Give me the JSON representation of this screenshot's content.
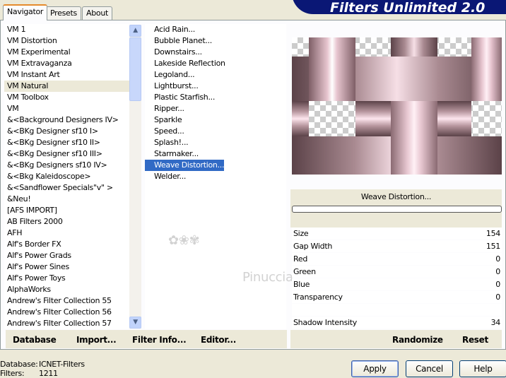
{
  "title": "Filters Unlimited 2.0",
  "tabs": [
    {
      "label": "Navigator"
    },
    {
      "label": "Presets"
    },
    {
      "label": "About"
    }
  ],
  "categories": [
    "VM 1",
    "VM Distortion",
    "VM Experimental",
    "VM Extravaganza",
    "VM Instant Art",
    "VM Natural",
    "VM Toolbox",
    "VM",
    "&<Background Designers IV>",
    "&<BKg Designer sf10 I>",
    "&<BKg Designer sf10 II>",
    "&<BKg Designer sf10 III>",
    "&<BKg Designers sf10 IV>",
    "&<Bkg Kaleidoscope>",
    "&<Sandflower Specials\"v\" >",
    "&Neu!",
    "[AFS IMPORT]",
    "AB Filters 2000",
    "AFH",
    "Alf's Border FX",
    "Alf's Power Grads",
    "Alf's Power Sines",
    "Alf's Power Toys",
    "AlphaWorks",
    "Andrew's Filter Collection 55",
    "Andrew's Filter Collection 56",
    "Andrew's Filter Collection 57"
  ],
  "selected_category": "VM Natural",
  "filters": [
    "Acid Rain...",
    "Bubble Planet...",
    "Downstairs...",
    "Lakeside Reflection",
    "Legoland...",
    "Lightburst...",
    "Plastic Starfish...",
    "Ripper...",
    "Sparkle",
    "Speed...",
    "Splash!...",
    "Starmaker...",
    "Weave Distortion...",
    "Welder..."
  ],
  "selected_filter": "Weave Distortion...",
  "filter_name": "Weave Distortion...",
  "params": [
    {
      "label": "Size",
      "value": "154"
    },
    {
      "label": "Gap Width",
      "value": "151"
    },
    {
      "label": "Red",
      "value": "0"
    },
    {
      "label": "Green",
      "value": "0"
    },
    {
      "label": "Blue",
      "value": "0"
    },
    {
      "label": "Transparency",
      "value": "0"
    },
    {
      "label": "",
      "value": ""
    },
    {
      "label": "Shadow Intensity",
      "value": "34"
    }
  ],
  "left_buttons": {
    "database": "Database",
    "import": "Import...",
    "filter_info": "Filter Info...",
    "editor": "Editor..."
  },
  "right_buttons": {
    "randomize": "Randomize",
    "reset": "Reset"
  },
  "status": {
    "database_label": "Database:",
    "database_value": "ICNET-Filters",
    "filters_label": "Filters:",
    "filters_value": "1211"
  },
  "dialog_buttons": {
    "apply": "Apply",
    "cancel": "Cancel",
    "help": "Help"
  },
  "watermark": "Pinuccia"
}
